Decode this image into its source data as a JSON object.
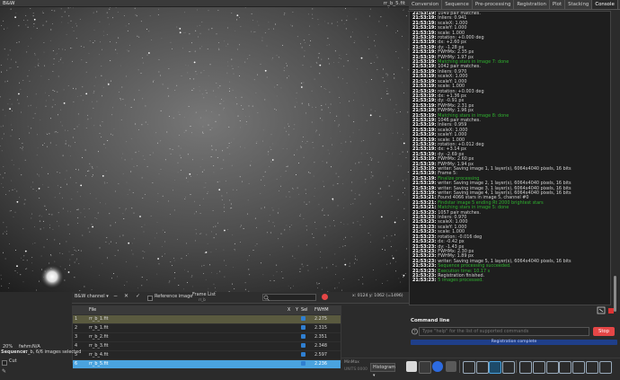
{
  "window": {
    "title": "B&W",
    "right_title": "rr_b_5.fit"
  },
  "tabs": [
    {
      "label": "Conversion",
      "active": false
    },
    {
      "label": "Sequence",
      "active": false
    },
    {
      "label": "Pre-processing",
      "active": false
    },
    {
      "label": "Registration",
      "active": false
    },
    {
      "label": "Plot",
      "active": false
    },
    {
      "label": "Stacking",
      "active": false
    },
    {
      "label": "Console",
      "active": true
    }
  ],
  "console_lines": [
    {
      "ts": "21:53:19:",
      "text": "1049 pair matches.",
      "green": false
    },
    {
      "ts": "21:53:19:",
      "text": "Inliers:      0.941",
      "green": false
    },
    {
      "ts": "21:53:19:",
      "text": "scaleX:       1.000",
      "green": false
    },
    {
      "ts": "21:53:19:",
      "text": "scaleY:       1.000",
      "green": false
    },
    {
      "ts": "21:53:19:",
      "text": "scale:        1.000",
      "green": false
    },
    {
      "ts": "21:53:19:",
      "text": "rotation:     +0.000 deg",
      "green": false
    },
    {
      "ts": "21:53:19:",
      "text": "dx:           +2.60 px",
      "green": false
    },
    {
      "ts": "21:53:19:",
      "text": "dy:           -1.28 px",
      "green": false
    },
    {
      "ts": "21:53:19:",
      "text": "FWHMx:        2.35 px",
      "green": false
    },
    {
      "ts": "21:53:19:",
      "text": "FWHMy:        1.97 px",
      "green": false
    },
    {
      "ts": "21:53:19:",
      "text": "Matching stars in image 7: done",
      "green": true
    },
    {
      "ts": "21:53:19:",
      "text": "1042 pair matches.",
      "green": false
    },
    {
      "ts": "21:53:19:",
      "text": "Inliers:      0.970",
      "green": false
    },
    {
      "ts": "21:53:19:",
      "text": "scaleX:       1.000",
      "green": false
    },
    {
      "ts": "21:53:19:",
      "text": "scaleY:       1.000",
      "green": false
    },
    {
      "ts": "21:53:19:",
      "text": "scale:        1.000",
      "green": false
    },
    {
      "ts": "21:53:19:",
      "text": "rotation:     +0.003 deg",
      "green": false
    },
    {
      "ts": "21:53:19:",
      "text": "dx:           +1.36 px",
      "green": false
    },
    {
      "ts": "21:53:19:",
      "text": "dy:           -0.91 px",
      "green": false
    },
    {
      "ts": "21:53:19:",
      "text": "FWHMx:        2.31 px",
      "green": false
    },
    {
      "ts": "21:53:19:",
      "text": "FWHMy:        1.96 px",
      "green": false
    },
    {
      "ts": "21:53:19:",
      "text": "Matching stars in image 8: done",
      "green": true
    },
    {
      "ts": "21:53:19:",
      "text": "1046 pair matches.",
      "green": false
    },
    {
      "ts": "21:53:19:",
      "text": "Inliers:      0.959",
      "green": false
    },
    {
      "ts": "21:53:19:",
      "text": "scaleX:       1.000",
      "green": false
    },
    {
      "ts": "21:53:19:",
      "text": "scaleY:       1.000",
      "green": false
    },
    {
      "ts": "21:53:19:",
      "text": "scale:        1.000",
      "green": false
    },
    {
      "ts": "21:53:19:",
      "text": "rotation:     +0.012 deg",
      "green": false
    },
    {
      "ts": "21:53:19:",
      "text": "dx:           +3.14 px",
      "green": false
    },
    {
      "ts": "21:53:19:",
      "text": "dy:           -2.69 px",
      "green": false
    },
    {
      "ts": "21:53:19:",
      "text": "FWHMx:        2.60 px",
      "green": false
    },
    {
      "ts": "21:53:19:",
      "text": "FWHMy:        1.94 px",
      "green": false
    },
    {
      "ts": "21:53:19:",
      "text": "writer: Saving image 1, 1 layer(s), 6064x4040 pixels, 16 bits",
      "green": false
    },
    {
      "ts": "21:53:19:",
      "text": "Frame 5:",
      "green": false
    },
    {
      "ts": "21:53:19:",
      "text": "Finalize processing",
      "green": true
    },
    {
      "ts": "21:53:19:",
      "text": "writer: Saving image 2, 1 layer(s), 6064x4040 pixels, 16 bits",
      "green": false
    },
    {
      "ts": "21:53:19:",
      "text": "writer: Saving image 3, 1 layer(s), 6064x4040 pixels, 16 bits",
      "green": false
    },
    {
      "ts": "21:53:19:",
      "text": "writer: Saving image 4, 1 layer(s), 6064x4040 pixels, 16 bits",
      "green": false
    },
    {
      "ts": "21:53:21:",
      "text": "Found 4066 stars in image 5, channel #0",
      "green": false
    },
    {
      "ts": "21:53:21:",
      "text": "Findstar image 5 ending Rt 2000 brightest stars",
      "green": true
    },
    {
      "ts": "21:53:21:",
      "text": "Matching stars in image 5: done",
      "green": true
    },
    {
      "ts": "21:53:23:",
      "text": "1057 pair matches.",
      "green": false
    },
    {
      "ts": "21:53:23:",
      "text": "Inliers:      0.970",
      "green": false
    },
    {
      "ts": "21:53:23:",
      "text": "scaleX:       1.000",
      "green": false
    },
    {
      "ts": "21:53:23:",
      "text": "scaleY:       1.000",
      "green": false
    },
    {
      "ts": "21:53:23:",
      "text": "scale:        1.000",
      "green": false
    },
    {
      "ts": "21:53:23:",
      "text": "rotation:     -0.016 deg",
      "green": false
    },
    {
      "ts": "21:53:23:",
      "text": "dx:           -0.42 px",
      "green": false
    },
    {
      "ts": "21:53:23:",
      "text": "dy:           -1.43 px",
      "green": false
    },
    {
      "ts": "21:53:23:",
      "text": "FWHMx:        2.30 px",
      "green": false
    },
    {
      "ts": "21:53:23:",
      "text": "FWHMy:        1.89 px",
      "green": false
    },
    {
      "ts": "21:53:23:",
      "text": "writer: Saving image 5, 1 layer(s), 6064x4040 pixels, 16 bits",
      "green": false
    },
    {
      "ts": "21:53:23:",
      "text": "Sequence processing succeeded.",
      "green": true
    },
    {
      "ts": "21:53:23:",
      "text": "Execution time: 10.17 s",
      "green": true
    },
    {
      "ts": "21:53:23:",
      "text": "Registration finished.",
      "green": false
    },
    {
      "ts": "21:53:23:",
      "text": "5 images processed.",
      "green": true
    }
  ],
  "command": {
    "label": "Command line",
    "placeholder": "Type \"help\" for the list of supported commands",
    "stop_label": "Stop",
    "progress_label": "Registration complete"
  },
  "view_toolbar": {
    "channel": "B&W channel",
    "reference": "Reference image",
    "frame_list": "Frame List",
    "frame_list_sub": "rr_b"
  },
  "table": {
    "headers": [
      "",
      "File",
      "X",
      "Y",
      "Sel",
      "FWHM"
    ],
    "rows": [
      {
        "idx": "1",
        "file": "rr_b_1.fit",
        "fwhm": "2.275",
        "style": "hl"
      },
      {
        "idx": "2",
        "file": "rr_b_1.fit",
        "fwhm": "2.315",
        "style": ""
      },
      {
        "idx": "3",
        "file": "rr_b_2.fit",
        "fwhm": "2.351",
        "style": ""
      },
      {
        "idx": "4",
        "file": "rr_b_3.fit",
        "fwhm": "2.348",
        "style": ""
      },
      {
        "idx": "5",
        "file": "rr_b_4.fit",
        "fwhm": "2.597",
        "style": ""
      },
      {
        "idx": "6",
        "file": "rr_b_5.fit",
        "fwhm": "2.236",
        "style": "sel"
      }
    ]
  },
  "left_panel": {
    "zoom": "20%",
    "fwhm_label": "fwhm:",
    "fwhm_value": "N/A",
    "sequence_label": "Sequence:",
    "sequence_text": "rr_b, 6/6 images selected",
    "cut_label": "Cut"
  },
  "status": {
    "coords": "x: 0124  y: 1062  (=1496)"
  },
  "display": {
    "mode": "Histogram",
    "min_label": "MinMax",
    "max_label": "UNITS:0000"
  },
  "colors": {
    "stop": "#e54646",
    "accent": "#4aa3df",
    "console_green": "#2fb12f",
    "progress": "#1f3f8a"
  }
}
